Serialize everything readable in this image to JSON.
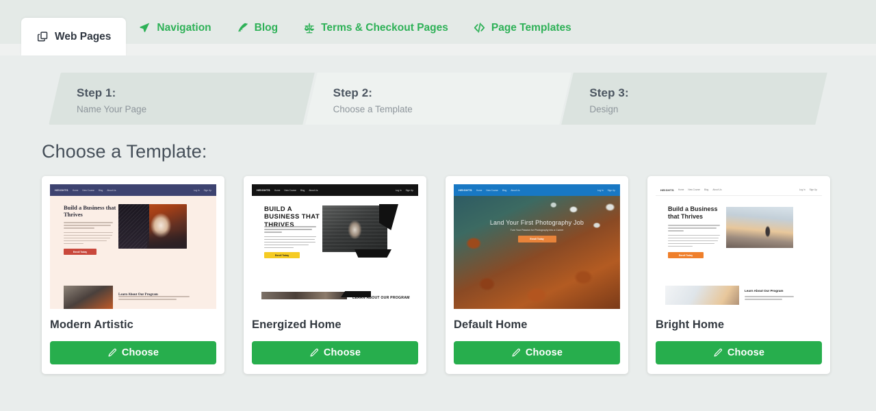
{
  "tabs": [
    {
      "label": "Web Pages",
      "icon": "copy-pages-icon",
      "active": true
    },
    {
      "label": "Navigation",
      "icon": "paper-plane-icon",
      "active": false
    },
    {
      "label": "Blog",
      "icon": "feather-icon",
      "active": false
    },
    {
      "label": "Terms & Checkout Pages",
      "icon": "scales-icon",
      "active": false
    },
    {
      "label": "Page Templates",
      "icon": "code-icon",
      "active": false
    }
  ],
  "steps": [
    {
      "title": "Step 1:",
      "sub": "Name Your Page"
    },
    {
      "title": "Step 2:",
      "sub": "Choose a Template"
    },
    {
      "title": "Step 3:",
      "sub": "Design"
    }
  ],
  "section": {
    "title": "Choose a Template:"
  },
  "choose_label": "Choose",
  "templates": [
    {
      "name": "Modern Artistic",
      "choose_label": "Choose",
      "preview": {
        "logo": "HEIGHTS",
        "nav_links": [
          "Home",
          "New Course",
          "Blog",
          "About Us"
        ],
        "nav_right": [
          "Log In",
          "Sign Up"
        ],
        "headline": "Build a Business that Thrives",
        "cta": "Enroll Today",
        "footer_heading": "Learn About Our Program"
      }
    },
    {
      "name": "Energized Home",
      "choose_label": "Choose",
      "preview": {
        "logo": "HEIGHTS",
        "nav_links": [
          "Home",
          "New Course",
          "Blog",
          "About Us"
        ],
        "nav_right": [
          "Log In",
          "Sign Up"
        ],
        "headline": "BUILD A BUSINESS THAT THRIVES",
        "cta": "Enroll Today",
        "footer_heading": "LEARN ABOUT OUR PROGRAM"
      }
    },
    {
      "name": "Default Home",
      "choose_label": "Choose",
      "preview": {
        "logo": "HEIGHTS",
        "nav_links": [
          "Home",
          "New Course",
          "Blog",
          "About Us"
        ],
        "nav_right": [
          "Log In",
          "Sign Up"
        ],
        "headline": "Land Your First Photography Job",
        "subhead": "Turn Your Passion for Photography into a Career",
        "cta": "Enroll Today"
      }
    },
    {
      "name": "Bright Home",
      "choose_label": "Choose",
      "preview": {
        "logo": "HEIGHTS",
        "nav_links": [
          "Home",
          "New Course",
          "Blog",
          "About Us"
        ],
        "nav_right": [
          "Log In",
          "Sign Up"
        ],
        "headline": "Build a Business that Thrives",
        "cta": "Enroll Today",
        "footer_heading": "Learn About Our Program"
      }
    }
  ],
  "colors": {
    "accent_green": "#2eb157",
    "button_green": "#27ae4d",
    "page_background": "#e9edec",
    "tabbar_background": "#e4eae7",
    "step_active": "#dbe3df",
    "step_inactive": "#eef2f0"
  }
}
